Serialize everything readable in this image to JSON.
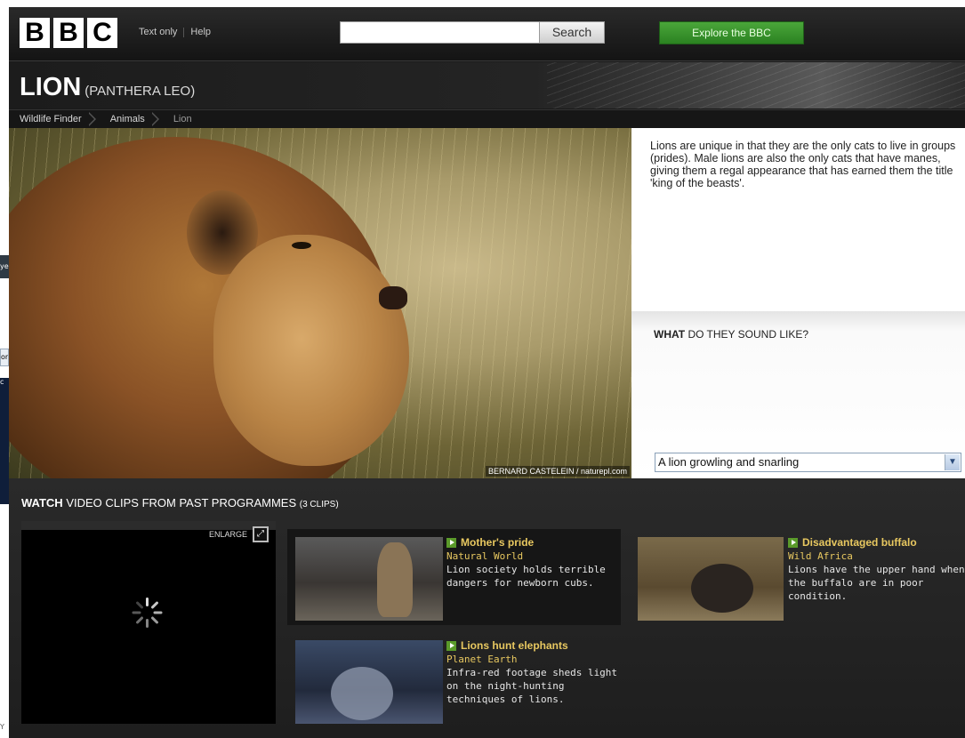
{
  "browser_fragments": {
    "frag1": "ye",
    "frag2": "ory",
    "frag3": "c",
    "frag4": "Y"
  },
  "header": {
    "logo_letters": [
      "B",
      "B",
      "C"
    ],
    "links": [
      "Text only",
      "Help"
    ],
    "search": {
      "placeholder": "",
      "button_label": "Search"
    },
    "explore_label": "Explore the BBC"
  },
  "title": {
    "main": "LION",
    "latin": "(PANTHERA LEO)"
  },
  "breadcrumb": [
    "Wildlife Finder",
    "Animals",
    "Lion"
  ],
  "hero": {
    "photo_credit": "BERNARD CASTELEIN / naturepl.com"
  },
  "info": {
    "description": "Lions are unique in that they are the only cats to live in groups (prides). Male lions are also the only cats that have manes, giving them a regal appearance that has earned them the title 'king of the beasts'."
  },
  "sound": {
    "title_bold": "WHAT",
    "title_rest": " DO THEY SOUND LIKE?",
    "selected": "A lion growling and snarling"
  },
  "videos": {
    "heading_bold": "WATCH",
    "heading_rest": " VIDEO CLIPS FROM PAST PROGRAMMES ",
    "count": "(3 CLIPS)",
    "enlarge_label": "ENLARGE",
    "clips": [
      {
        "title": "Mother's pride",
        "programme": "Natural World",
        "desc": "Lion society holds terrible dangers for newborn cubs."
      },
      {
        "title": "Lions hunt elephants",
        "programme": "Planet Earth",
        "desc": "Infra-red footage sheds light on the night-hunting techniques of lions."
      },
      {
        "title": "Disadvantaged buffalo",
        "programme": "Wild Africa",
        "desc": "Lions have the upper hand when the buffalo are in poor condition."
      }
    ]
  }
}
